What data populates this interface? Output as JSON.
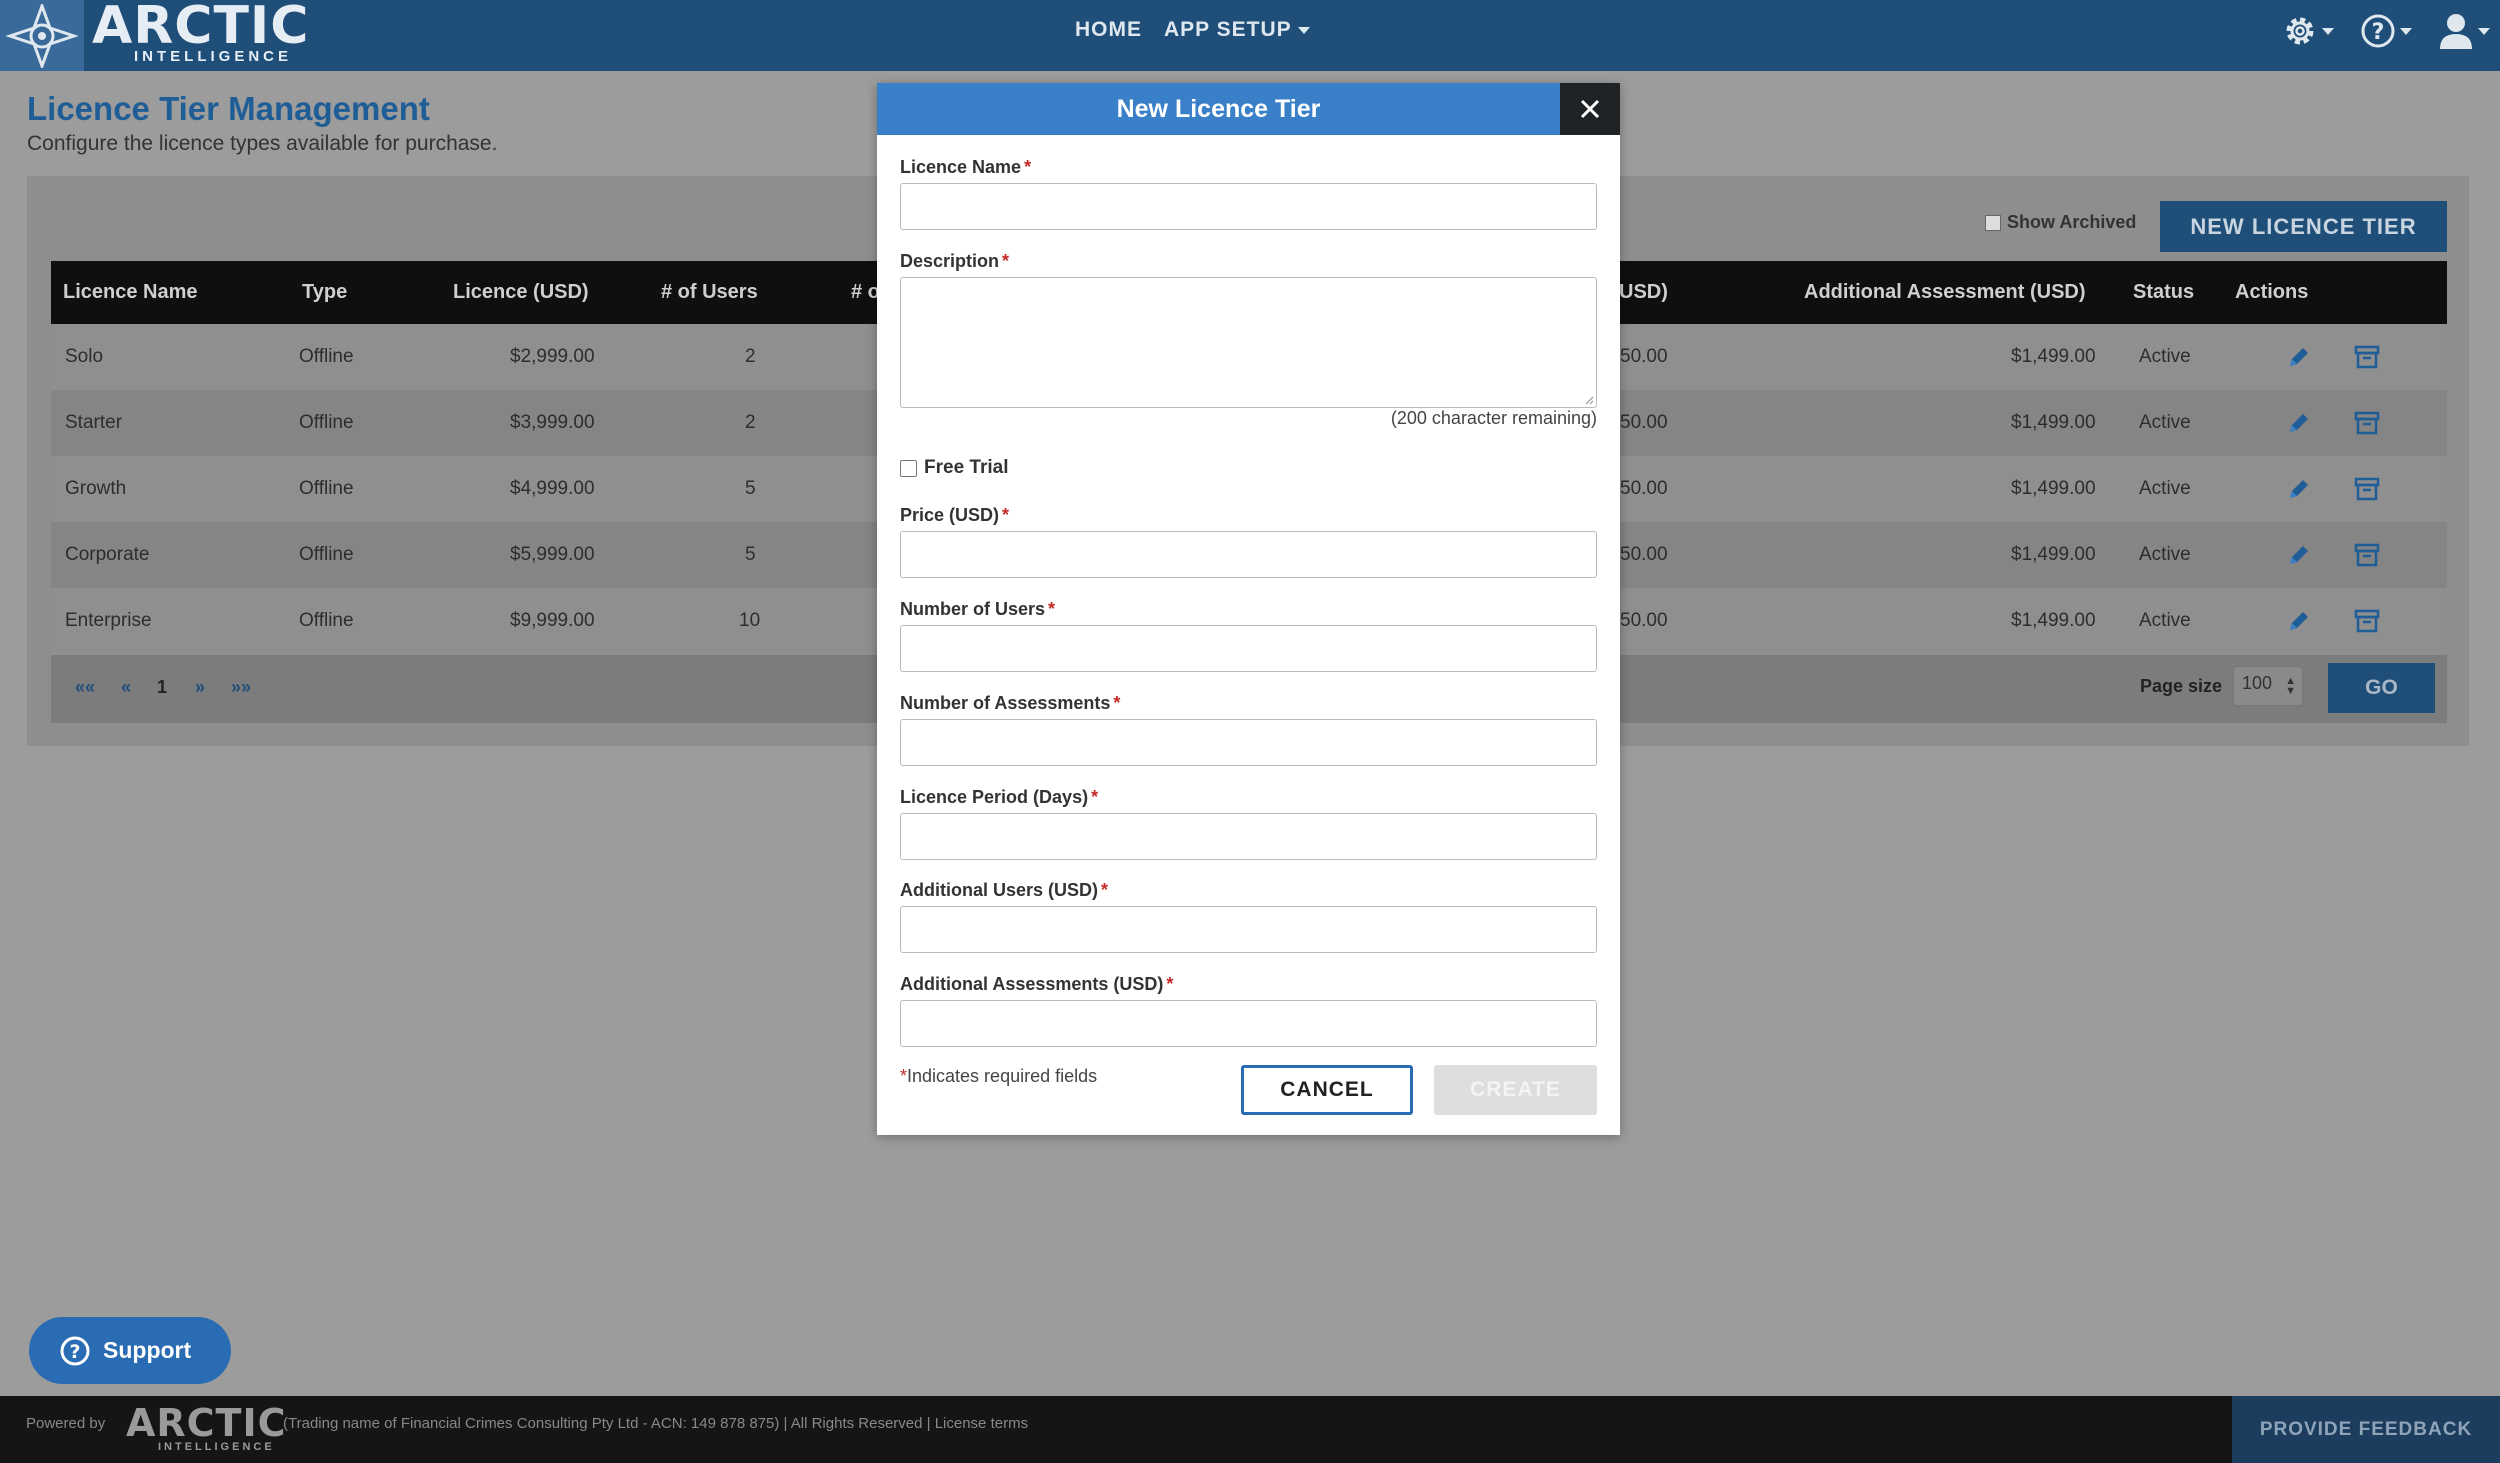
{
  "brand": {
    "name": "ARCTIC",
    "sub": "INTELLIGENCE"
  },
  "nav": {
    "home": "HOME",
    "app_setup": "APP SETUP"
  },
  "page": {
    "title": "Licence Tier Management",
    "subtitle": "Configure the licence types available for purchase."
  },
  "toolbar": {
    "show_archived": "Show Archived",
    "new_tier": "NEW LICENCE TIER"
  },
  "table": {
    "headers": {
      "name": "Licence Name",
      "type": "Type",
      "licence": "Licence (USD)",
      "users": "# of Users",
      "assess": "# o",
      "addusers": "USD)",
      "addassess": "Additional Assessment (USD)",
      "status": "Status",
      "actions": "Actions"
    },
    "rows": [
      {
        "name": "Solo",
        "type": "Offline",
        "licence": "$2,999.00",
        "users": "2",
        "addusers": "50.00",
        "addassess": "$1,499.00",
        "status": "Active"
      },
      {
        "name": "Starter",
        "type": "Offline",
        "licence": "$3,999.00",
        "users": "2",
        "addusers": "50.00",
        "addassess": "$1,499.00",
        "status": "Active"
      },
      {
        "name": "Growth",
        "type": "Offline",
        "licence": "$4,999.00",
        "users": "5",
        "addusers": "50.00",
        "addassess": "$1,499.00",
        "status": "Active"
      },
      {
        "name": "Corporate",
        "type": "Offline",
        "licence": "$5,999.00",
        "users": "5",
        "addusers": "50.00",
        "addassess": "$1,499.00",
        "status": "Active"
      },
      {
        "name": "Enterprise",
        "type": "Offline",
        "licence": "$9,999.00",
        "users": "10",
        "addusers": "50.00",
        "addassess": "$1,499.00",
        "status": "Active"
      }
    ]
  },
  "pager": {
    "first": "««",
    "prev": "«",
    "page": "1",
    "next": "»",
    "last": "»»",
    "page_size_label": "Page size",
    "page_size": "100",
    "go": "GO"
  },
  "modal": {
    "title": "New Licence Tier",
    "fields": {
      "name": "Licence Name",
      "description": "Description",
      "remaining": "(200 character remaining)",
      "free_trial": "Free Trial",
      "price": "Price (USD)",
      "users": "Number of Users",
      "assessments": "Number of Assessments",
      "period": "Licence Period (Days)",
      "add_users": "Additional Users (USD)",
      "add_assessments": "Additional Assessments (USD)"
    },
    "required_marker": "*",
    "required_note": "Indicates required fields",
    "cancel": "CANCEL",
    "create": "CREATE"
  },
  "support": {
    "label": "Support"
  },
  "footer": {
    "powered": "Powered by",
    "logo": "ARCTIC",
    "logo_sub": "INTELLIGENCE",
    "text": "(Trading name of Financial Crimes Consulting Pty Ltd - ACN: 149 878 875) | All Rights Reserved | License terms",
    "feedback": "PROVIDE FEEDBACK"
  },
  "colors": {
    "nav": "#1f4e79",
    "accent": "#3a80c9",
    "overlay_bg": "#9c9c9c",
    "required": "#c62828"
  },
  "icons": [
    "logo-compass-icon",
    "gear-icon",
    "help-icon",
    "user-icon",
    "close-icon",
    "pencil-icon",
    "archive-icon",
    "question-circle-icon",
    "caret-down-icon"
  ]
}
